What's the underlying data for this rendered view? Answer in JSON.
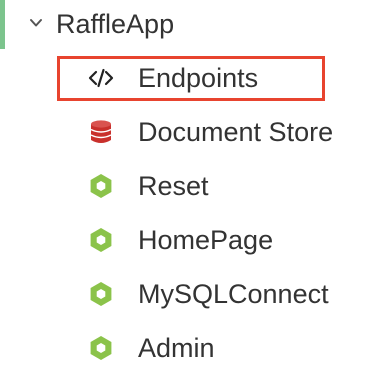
{
  "tree": {
    "root": {
      "label": "RaffleApp",
      "icon": "chevron-down-icon",
      "expanded": true,
      "accent_color": "#7cc48d"
    },
    "children": [
      {
        "label": "Endpoints",
        "icon": "code-icon",
        "icon_color": "#222222",
        "selected": true
      },
      {
        "label": "Document Store",
        "icon": "database-icon",
        "icon_color": "#c9302c"
      },
      {
        "label": "Reset",
        "icon": "hexagon-icon",
        "icon_color": "#8bc34a"
      },
      {
        "label": "HomePage",
        "icon": "hexagon-icon",
        "icon_color": "#8bc34a"
      },
      {
        "label": "MySQLConnect",
        "icon": "hexagon-icon",
        "icon_color": "#8bc34a"
      },
      {
        "label": "Admin",
        "icon": "hexagon-icon",
        "icon_color": "#8bc34a"
      }
    ],
    "selection_color": "#e8442f"
  }
}
